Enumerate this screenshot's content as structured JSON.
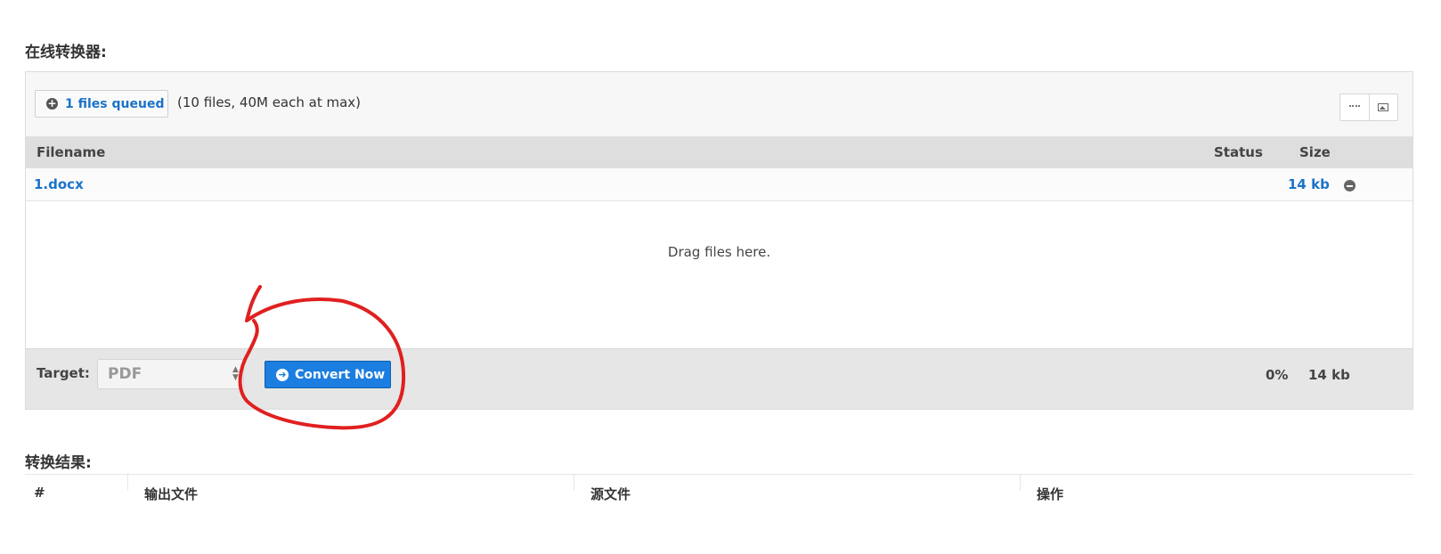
{
  "converter": {
    "title": "在线转换器:",
    "queue_button_label": "1 files queued",
    "limit_note": "(10 files, 40M each at max)",
    "columns": {
      "filename": "Filename",
      "status": "Status",
      "size": "Size"
    },
    "files": [
      {
        "name": "1.docx",
        "size": "14 kb"
      }
    ],
    "drop_hint": "Drag files here.",
    "target_label": "Target:",
    "target_value": "PDF",
    "convert_button_label": "Convert Now",
    "progress_text": "0%",
    "total_size": "14 kb"
  },
  "results": {
    "title": "转换结果:",
    "columns": [
      "#",
      "输出文件",
      "源文件",
      "操作"
    ]
  },
  "colors": {
    "link_blue": "#1a73c8",
    "button_blue": "#1b7ee0",
    "annotation_red": "#e02020"
  },
  "icons": {
    "add": "plus-circle-icon",
    "remove": "minus-circle-icon",
    "convert": "arrow-right-circle-icon",
    "list_view": "list-view-icon",
    "thumbnail_view": "image-icon"
  }
}
